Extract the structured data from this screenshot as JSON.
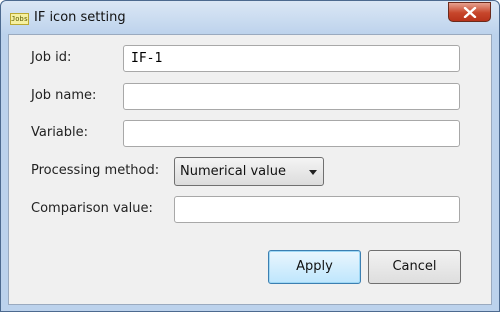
{
  "window": {
    "title": "IF icon setting",
    "app_icon_text": "Jobs",
    "close_icon": "close-icon"
  },
  "form": {
    "job_id": {
      "label": "Job id:",
      "value": "IF-1"
    },
    "job_name": {
      "label": "Job name:",
      "value": ""
    },
    "variable": {
      "label": "Variable:",
      "value": ""
    },
    "processing_method": {
      "label": "Processing method:",
      "selected": "Numerical value"
    },
    "comparison_value": {
      "label": "Comparison value:",
      "value": ""
    }
  },
  "buttons": {
    "apply": "Apply",
    "cancel": "Cancel"
  }
}
